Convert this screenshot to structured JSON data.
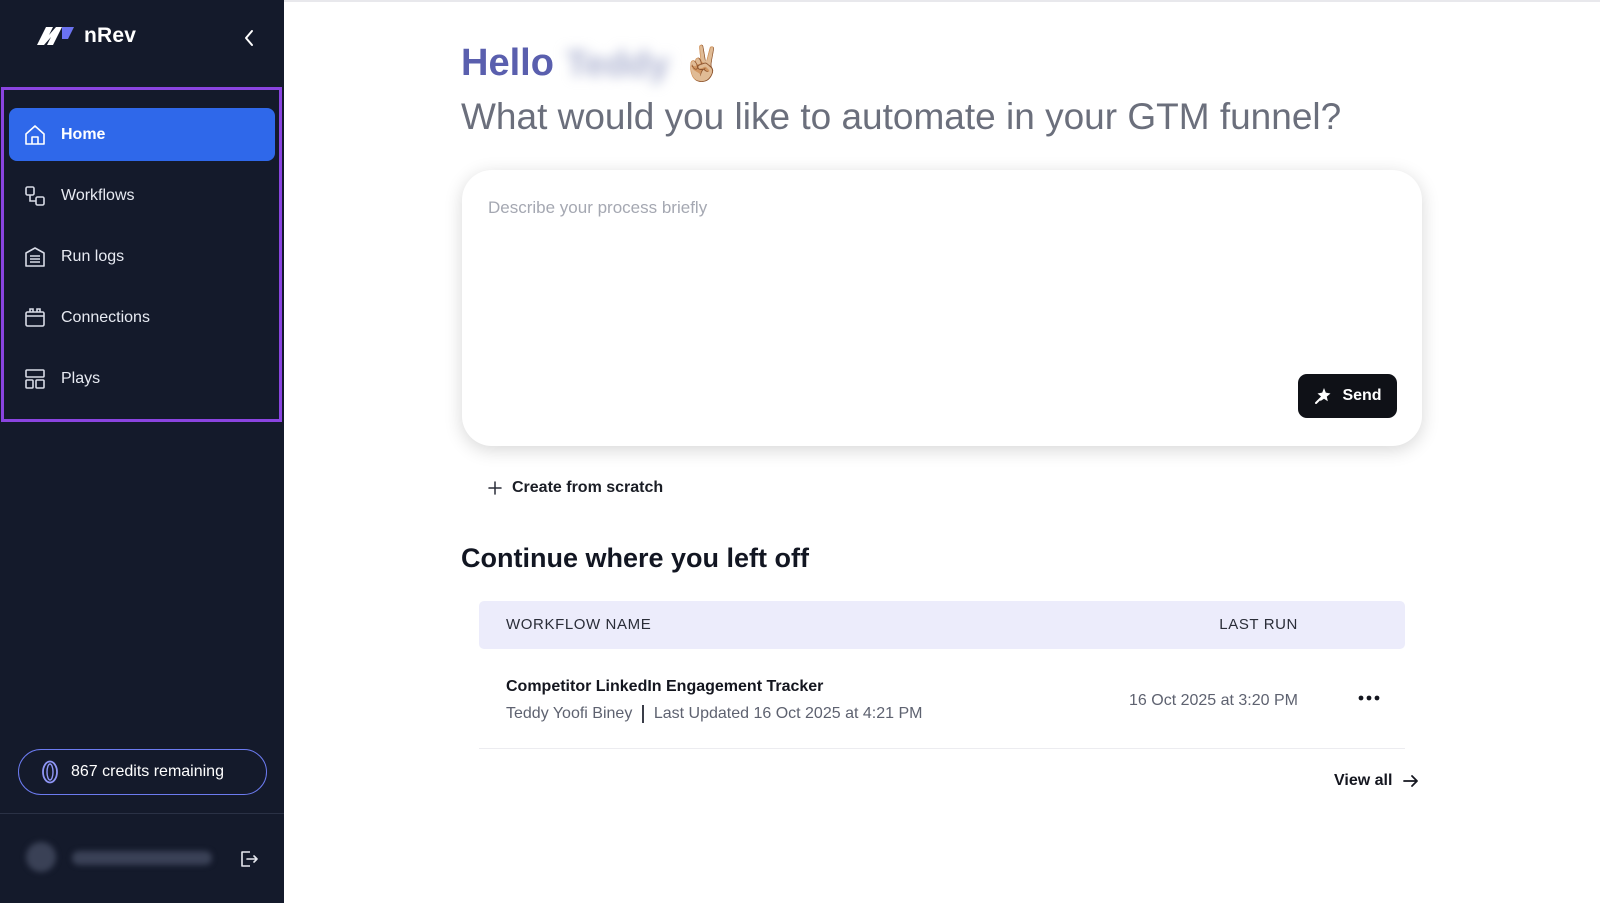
{
  "app": {
    "name": "nRev"
  },
  "sidebar": {
    "items": [
      {
        "label": "Home",
        "icon": "home-icon",
        "active": true
      },
      {
        "label": "Workflows",
        "icon": "workflow-icon",
        "active": false
      },
      {
        "label": "Run logs",
        "icon": "run-logs-icon",
        "active": false
      },
      {
        "label": "Connections",
        "icon": "connections-icon",
        "active": false
      },
      {
        "label": "Plays",
        "icon": "plays-icon",
        "active": false
      }
    ],
    "credits_label": "867 credits remaining"
  },
  "main": {
    "hello": "Hello",
    "user_first_name": "Teddy",
    "wave_emoji": "✌🏼",
    "headline": "What would you like to automate in your GTM funnel?",
    "prompt": {
      "placeholder": "Describe your process briefly",
      "value": ""
    },
    "send_label": "Send",
    "create_label": "Create from scratch",
    "section_title": "Continue where you left off",
    "table": {
      "columns": [
        "WORKFLOW NAME",
        "LAST RUN"
      ],
      "rows": [
        {
          "name": "Competitor LinkedIn Engagement Tracker",
          "owner": "Teddy Yoofi Biney",
          "updated": "Last Updated 16 Oct 2025 at 4:21 PM",
          "last_run": "16 Oct 2025 at 3:20 PM"
        }
      ]
    },
    "view_all_label": "View all"
  },
  "colors": {
    "sidebar_bg": "#141a2b",
    "active_item": "#2f68ea",
    "highlight_border": "#8a44e0",
    "hello_accent": "#5a5fae",
    "table_header_bg": "#ececfb"
  }
}
